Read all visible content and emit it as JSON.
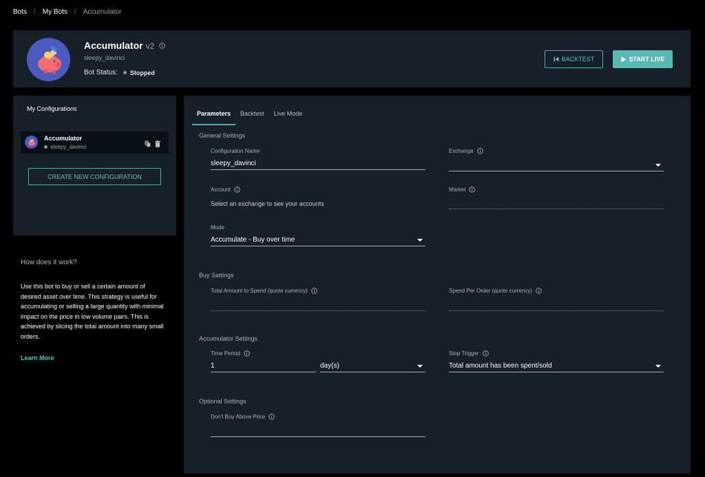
{
  "breadcrumb": {
    "root": "Bots",
    "parent": "My Bots",
    "current": "Accumulator"
  },
  "header": {
    "name": "Accumulator",
    "version": "v2",
    "subtitle": "sleepy_davinci",
    "status_label": "Bot Status:",
    "status_value": "Stopped",
    "backtest_label": "BACKTEST",
    "start_live_label": "START LIVE"
  },
  "configs": {
    "title": "My Configurations",
    "items": [
      {
        "name": "Accumulator",
        "subtitle": "sleepy_davinci"
      }
    ],
    "create_label": "CREATE NEW CONFIGURATION"
  },
  "how": {
    "heading": "How does it work?",
    "body": "Use this bot to buy or sell a certain amount of desired asset over time. This strategy is useful for accumulating or selling a large quantity with minimal impact on the price in low volume pairs. This is achieved by slicing the total amount into many small orders.",
    "learn_more": "Learn More"
  },
  "tabs": [
    "Parameters",
    "Backtest",
    "Live Mode"
  ],
  "form": {
    "general_title": "General Settings",
    "config_name_label": "Configuration Name",
    "config_name_value": "sleepy_davinci",
    "exchange_label": "Exchange",
    "exchange_value": "",
    "account_label": "Account",
    "account_hint": "Select an exchange to see your accounts",
    "market_label": "Market",
    "market_value": "",
    "mode_label": "Mode",
    "mode_value": "Accumulate - Buy over time",
    "buy_title": "Buy Settings",
    "total_label": "Total Amount to Spend (quote currency)",
    "total_value": "",
    "per_order_label": "Spend Per Order (quote currency)",
    "per_order_value": "",
    "acc_title": "Accumulator Settings",
    "time_period_label": "Time Period",
    "time_period_value": "1",
    "time_unit_value": "day(s)",
    "stop_trigger_label": "Stop Trigger",
    "stop_trigger_value": "Total amount has been spent/sold",
    "optional_title": "Optional Settings",
    "dont_buy_label": "Don't Buy Above Price",
    "dont_buy_value": ""
  },
  "colors": {
    "accent": "#4fb0b0",
    "panel": "#172029",
    "background": "#000000",
    "avatar": "#4c5bbf",
    "piggy": "#f06e72"
  }
}
